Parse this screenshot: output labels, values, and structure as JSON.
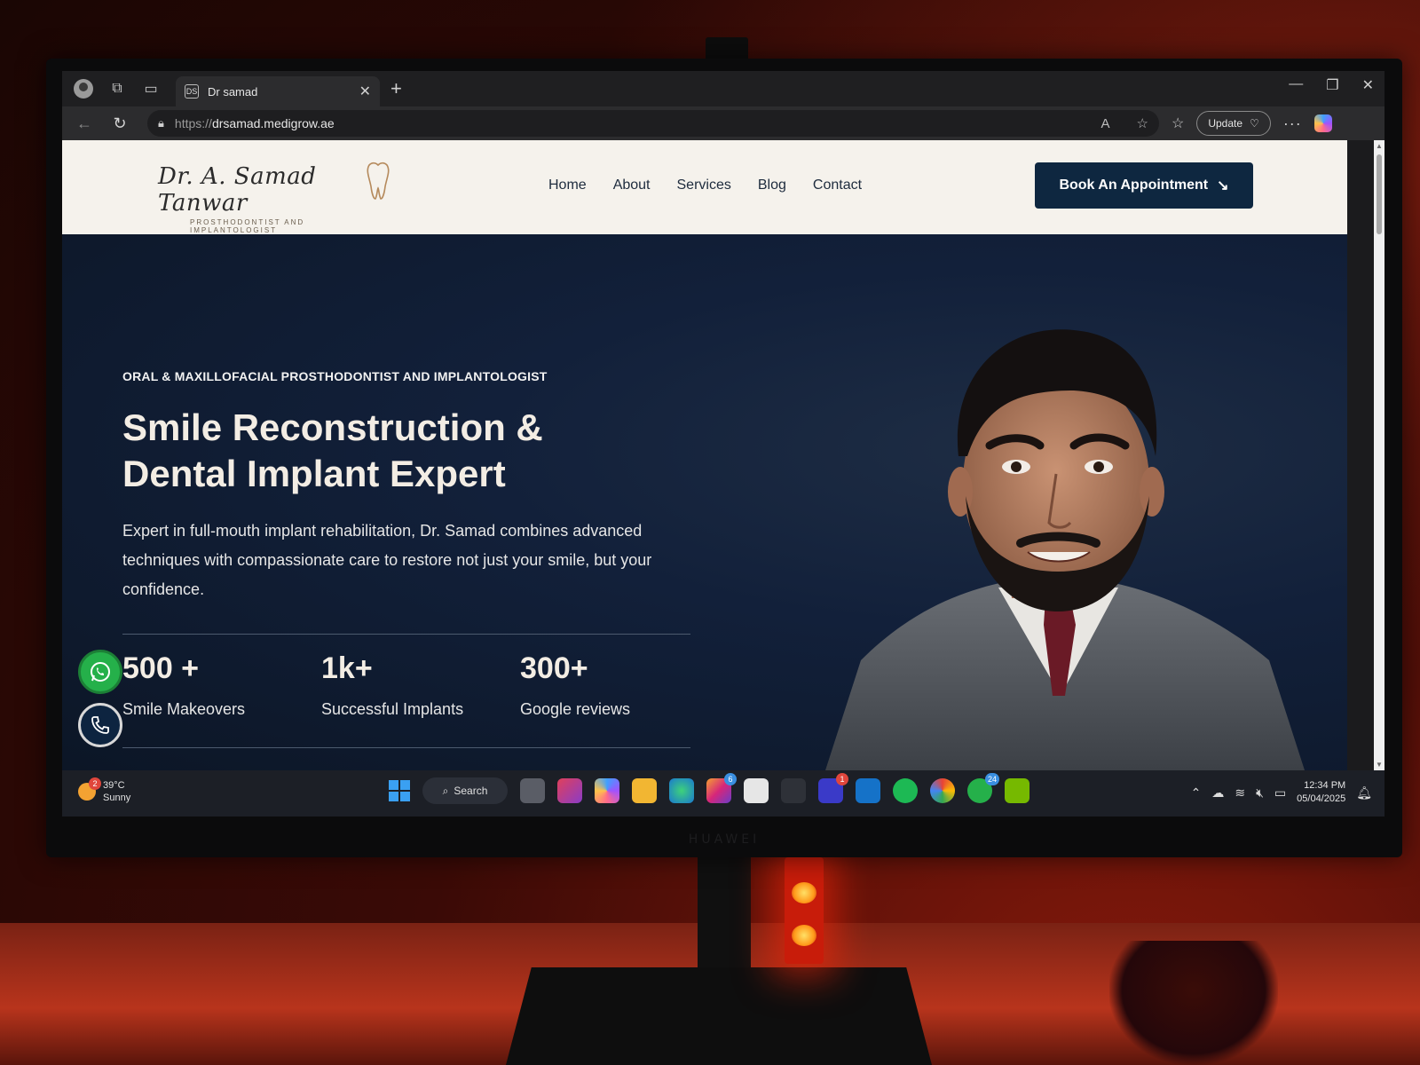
{
  "browser": {
    "tab_title": "Dr samad",
    "tab_favicon": "DS",
    "url_scheme": "https://",
    "url_host": "drsamad.medigrow.ae",
    "update_label": "Update",
    "window_controls": [
      "—",
      "❐",
      "✕"
    ]
  },
  "site": {
    "logo_script": "Dr. A. Samad Tanwar",
    "logo_subtitle": "PROSTHODONTIST AND IMPLANTOLOGIST",
    "nav": [
      "Home",
      "About",
      "Services",
      "Blog",
      "Contact"
    ],
    "cta_label": "Book An Appointment",
    "eyebrow": "ORAL & MAXILLOFACIAL PROSTHODONTIST AND IMPLANTOLOGIST",
    "headline_line1": "Smile Reconstruction &",
    "headline_line2": "Dental Implant Expert",
    "description": "Expert in full-mouth implant rehabilitation, Dr. Samad combines advanced techniques with compassionate care to restore not just your smile, but your confidence.",
    "stats": [
      {
        "number": "500 +",
        "label": "Smile Makeovers"
      },
      {
        "number": "1k+",
        "label": "Successful Implants"
      },
      {
        "number": "300+",
        "label": "Google reviews"
      }
    ]
  },
  "taskbar": {
    "weather_badge": "2",
    "temperature": "39°C",
    "condition": "Sunny",
    "search_label": "Search",
    "badges": {
      "instagram": "6",
      "teams": "1",
      "whatsapp": "24"
    },
    "time": "12:34 PM",
    "date": "05/04/2025"
  },
  "monitor_brand": "HUAWEI",
  "colors": {
    "header_bg": "#f5f2ec",
    "hero_bg": "#12203a",
    "cta_bg": "#0e2740",
    "whatsapp": "#25b04a"
  }
}
